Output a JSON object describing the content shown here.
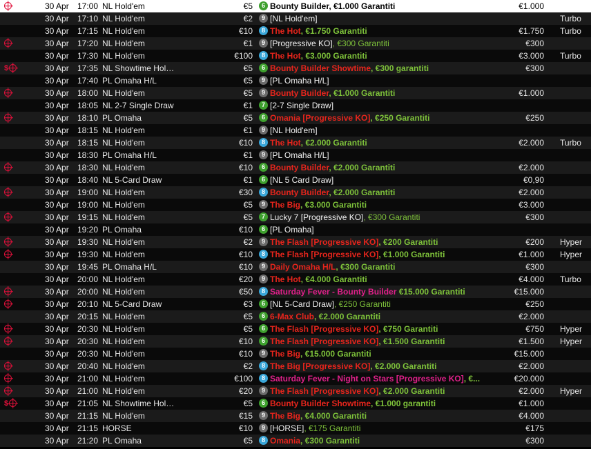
{
  "tournaments": [
    {
      "bounty": true,
      "cash": false,
      "date": "30 Apr",
      "time": "17:00",
      "game": "NL Hold'em",
      "buyin": "€5",
      "seats": "6",
      "name": [
        [
          "Bounty Builder, €1.000 Garantiti",
          "white"
        ]
      ],
      "prize": "€1.000",
      "speed": "",
      "selected": true
    },
    {
      "bounty": false,
      "cash": false,
      "date": "30 Apr",
      "time": "17:10",
      "game": "NL Hold'em",
      "buyin": "€2",
      "seats": "9",
      "name": [
        [
          "[NL Hold'em]",
          "white"
        ]
      ],
      "prize": "",
      "speed": "Turbo"
    },
    {
      "bounty": false,
      "cash": false,
      "date": "30 Apr",
      "time": "17:15",
      "game": "NL Hold'em",
      "buyin": "€10",
      "seats": "8",
      "name": [
        [
          "The Hot",
          "red"
        ],
        [
          ", €1.750 Garantiti",
          "greenb"
        ]
      ],
      "prize": "€1.750",
      "speed": "Turbo"
    },
    {
      "bounty": true,
      "cash": false,
      "date": "30 Apr",
      "time": "17:20",
      "game": "NL Hold'em",
      "buyin": "€1",
      "seats": "9",
      "name": [
        [
          "[Progressive KO]",
          "white"
        ],
        [
          ", €300 Garantiti",
          "green"
        ]
      ],
      "prize": "€300",
      "speed": ""
    },
    {
      "bounty": false,
      "cash": false,
      "date": "30 Apr",
      "time": "17:30",
      "game": "NL Hold'em",
      "buyin": "€100",
      "seats": "8",
      "name": [
        [
          "The Hot",
          "red"
        ],
        [
          ", €3.000 Garantiti",
          "greenb"
        ]
      ],
      "prize": "€3.000",
      "speed": "Turbo"
    },
    {
      "bounty": true,
      "cash": true,
      "date": "30 Apr",
      "time": "17:35",
      "game": "NL Showtime Hold'…",
      "buyin": "€5",
      "seats": "6",
      "name": [
        [
          "Bounty Builder Showtime",
          "red"
        ],
        [
          ", €300 garantiti",
          "greenb"
        ]
      ],
      "prize": "€300",
      "speed": ""
    },
    {
      "bounty": false,
      "cash": false,
      "date": "30 Apr",
      "time": "17:40",
      "game": "PL Omaha H/L",
      "buyin": "€5",
      "seats": "9",
      "name": [
        [
          "[PL Omaha H/L]",
          "white"
        ]
      ],
      "prize": "",
      "speed": ""
    },
    {
      "bounty": true,
      "cash": false,
      "date": "30 Apr",
      "time": "18:00",
      "game": "NL Hold'em",
      "buyin": "€5",
      "seats": "9",
      "name": [
        [
          "Bounty Builder",
          "red"
        ],
        [
          ", €1.000 Garantiti",
          "greenb"
        ]
      ],
      "prize": "€1.000",
      "speed": ""
    },
    {
      "bounty": false,
      "cash": false,
      "date": "30 Apr",
      "time": "18:05",
      "game": "NL 2-7 Single Draw",
      "buyin": "€1",
      "seats": "7",
      "name": [
        [
          "[2-7 Single Draw]",
          "white"
        ]
      ],
      "prize": "",
      "speed": ""
    },
    {
      "bounty": true,
      "cash": false,
      "date": "30 Apr",
      "time": "18:10",
      "game": "PL Omaha",
      "buyin": "€5",
      "seats": "6",
      "name": [
        [
          "Omania [Progressive KO]",
          "red"
        ],
        [
          ", €250 Garantiti",
          "greenb"
        ]
      ],
      "prize": "€250",
      "speed": ""
    },
    {
      "bounty": false,
      "cash": false,
      "date": "30 Apr",
      "time": "18:15",
      "game": "NL Hold'em",
      "buyin": "€1",
      "seats": "9",
      "name": [
        [
          "[NL Hold'em]",
          "white"
        ]
      ],
      "prize": "",
      "speed": ""
    },
    {
      "bounty": false,
      "cash": false,
      "date": "30 Apr",
      "time": "18:15",
      "game": "NL Hold'em",
      "buyin": "€10",
      "seats": "8",
      "name": [
        [
          "The Hot",
          "red"
        ],
        [
          ", €2.000 Garantiti",
          "greenb"
        ]
      ],
      "prize": "€2.000",
      "speed": "Turbo"
    },
    {
      "bounty": false,
      "cash": false,
      "date": "30 Apr",
      "time": "18:30",
      "game": "PL Omaha H/L",
      "buyin": "€1",
      "seats": "9",
      "name": [
        [
          "[PL Omaha H/L]",
          "white"
        ]
      ],
      "prize": "",
      "speed": ""
    },
    {
      "bounty": true,
      "cash": false,
      "date": "30 Apr",
      "time": "18:30",
      "game": "NL Hold'em",
      "buyin": "€10",
      "seats": "6",
      "name": [
        [
          "Bounty Builder",
          "red"
        ],
        [
          ", €2.000 Garantiti",
          "greenb"
        ]
      ],
      "prize": "€2.000",
      "speed": ""
    },
    {
      "bounty": false,
      "cash": false,
      "date": "30 Apr",
      "time": "18:40",
      "game": "NL 5-Card Draw",
      "buyin": "€1",
      "seats": "6",
      "name": [
        [
          "[NL 5 Card Draw]",
          "white"
        ]
      ],
      "prize": "€0,90",
      "speed": ""
    },
    {
      "bounty": true,
      "cash": false,
      "date": "30 Apr",
      "time": "19:00",
      "game": "NL Hold'em",
      "buyin": "€30",
      "seats": "8",
      "name": [
        [
          "Bounty Builder",
          "red"
        ],
        [
          ", €2.000 Garantiti",
          "greenb"
        ]
      ],
      "prize": "€2.000",
      "speed": ""
    },
    {
      "bounty": false,
      "cash": false,
      "date": "30 Apr",
      "time": "19:00",
      "game": "NL Hold'em",
      "buyin": "€5",
      "seats": "9",
      "name": [
        [
          "The Big",
          "red"
        ],
        [
          ", €3.000 Garantiti",
          "greenb"
        ]
      ],
      "prize": "€3.000",
      "speed": ""
    },
    {
      "bounty": true,
      "cash": false,
      "date": "30 Apr",
      "time": "19:15",
      "game": "NL Hold'em",
      "buyin": "€5",
      "seats": "7",
      "name": [
        [
          "Lucky 7 [Progressive KO]",
          "white"
        ],
        [
          ", €300 Garantiti",
          "green"
        ]
      ],
      "prize": "€300",
      "speed": ""
    },
    {
      "bounty": false,
      "cash": false,
      "date": "30 Apr",
      "time": "19:20",
      "game": "PL Omaha",
      "buyin": "€10",
      "seats": "6",
      "name": [
        [
          "[PL Omaha]",
          "white"
        ]
      ],
      "prize": "",
      "speed": ""
    },
    {
      "bounty": true,
      "cash": false,
      "date": "30 Apr",
      "time": "19:30",
      "game": "NL Hold'em",
      "buyin": "€2",
      "seats": "9",
      "name": [
        [
          "The Flash [Progressive KO]",
          "red"
        ],
        [
          ", €200 Garantiti",
          "greenb"
        ]
      ],
      "prize": "€200",
      "speed": "Hyper"
    },
    {
      "bounty": true,
      "cash": false,
      "date": "30 Apr",
      "time": "19:30",
      "game": "NL Hold'em",
      "buyin": "€10",
      "seats": "8",
      "name": [
        [
          "The Flash [Progressive KO]",
          "red"
        ],
        [
          ", €1.000 Garantiti",
          "greenb"
        ]
      ],
      "prize": "€1.000",
      "speed": "Hyper"
    },
    {
      "bounty": false,
      "cash": false,
      "date": "30 Apr",
      "time": "19:45",
      "game": "PL Omaha H/L",
      "buyin": "€10",
      "seats": "9",
      "name": [
        [
          "Daily Omaha H/L",
          "red"
        ],
        [
          ", €300 Garantiti",
          "greenb"
        ]
      ],
      "prize": "€300",
      "speed": ""
    },
    {
      "bounty": false,
      "cash": false,
      "date": "30 Apr",
      "time": "20:00",
      "game": "NL Hold'em",
      "buyin": "€20",
      "seats": "9",
      "name": [
        [
          "The Hot",
          "red"
        ],
        [
          ", €4.000 Garantiti",
          "greenb"
        ]
      ],
      "prize": "€4.000",
      "speed": "Turbo"
    },
    {
      "bounty": true,
      "cash": false,
      "date": "30 Apr",
      "time": "20:00",
      "game": "NL Hold'em",
      "buyin": "€50",
      "seats": "8",
      "name": [
        [
          "Saturday Fever - Bounty Builder",
          "pink"
        ],
        [
          " €15.000 Garantiti",
          "greenb"
        ]
      ],
      "prize": "€15.000",
      "speed": ""
    },
    {
      "bounty": true,
      "cash": false,
      "date": "30 Apr",
      "time": "20:10",
      "game": "NL 5-Card Draw",
      "buyin": "€3",
      "seats": "6",
      "name": [
        [
          "[NL 5-Card Draw]",
          "white"
        ],
        [
          ", €250 Garantiti",
          "green"
        ]
      ],
      "prize": "€250",
      "speed": ""
    },
    {
      "bounty": false,
      "cash": false,
      "date": "30 Apr",
      "time": "20:15",
      "game": "NL Hold'em",
      "buyin": "€5",
      "seats": "6",
      "name": [
        [
          "6-Max Club",
          "red"
        ],
        [
          ", €2.000 Garantiti",
          "greenb"
        ]
      ],
      "prize": "€2.000",
      "speed": ""
    },
    {
      "bounty": true,
      "cash": false,
      "date": "30 Apr",
      "time": "20:30",
      "game": "NL Hold'em",
      "buyin": "€5",
      "seats": "6",
      "name": [
        [
          "The Flash [Progressive KO]",
          "red"
        ],
        [
          ", €750 Garantiti",
          "greenb"
        ]
      ],
      "prize": "€750",
      "speed": "Hyper"
    },
    {
      "bounty": true,
      "cash": false,
      "date": "30 Apr",
      "time": "20:30",
      "game": "NL Hold'em",
      "buyin": "€10",
      "seats": "6",
      "name": [
        [
          "The Flash [Progressive KO]",
          "red"
        ],
        [
          ", €1.500 Garantiti",
          "greenb"
        ]
      ],
      "prize": "€1.500",
      "speed": "Hyper"
    },
    {
      "bounty": false,
      "cash": false,
      "date": "30 Apr",
      "time": "20:30",
      "game": "NL Hold'em",
      "buyin": "€10",
      "seats": "9",
      "name": [
        [
          "The Big",
          "red"
        ],
        [
          ", €15.000 Garantiti",
          "greenb"
        ]
      ],
      "prize": "€15.000",
      "speed": ""
    },
    {
      "bounty": true,
      "cash": false,
      "date": "30 Apr",
      "time": "20:40",
      "game": "NL Hold'em",
      "buyin": "€2",
      "seats": "8",
      "name": [
        [
          "The Big [Progressive KO]",
          "red"
        ],
        [
          ", €2.000 Garantiti",
          "greenb"
        ]
      ],
      "prize": "€2.000",
      "speed": ""
    },
    {
      "bounty": true,
      "cash": false,
      "date": "30 Apr",
      "time": "21:00",
      "game": "NL Hold'em",
      "buyin": "€100",
      "seats": "8",
      "name": [
        [
          "Saturday Fever - Night on Stars [Progressive KO]",
          "pink"
        ],
        [
          ", €...",
          "greenb"
        ]
      ],
      "prize": "€20.000",
      "speed": ""
    },
    {
      "bounty": true,
      "cash": false,
      "date": "30 Apr",
      "time": "21:00",
      "game": "NL Hold'em",
      "buyin": "€20",
      "seats": "9",
      "name": [
        [
          "The Flash [Progressive KO]",
          "red"
        ],
        [
          ", €2.000 Garantiti",
          "greenb"
        ]
      ],
      "prize": "€2.000",
      "speed": "Hyper"
    },
    {
      "bounty": true,
      "cash": true,
      "date": "30 Apr",
      "time": "21:05",
      "game": "NL Showtime Hold'…",
      "buyin": "€5",
      "seats": "6",
      "name": [
        [
          "Bounty Builder Showtime",
          "red"
        ],
        [
          ", €1.000 garantiti",
          "greenb"
        ]
      ],
      "prize": "€1.000",
      "speed": ""
    },
    {
      "bounty": false,
      "cash": false,
      "date": "30 Apr",
      "time": "21:15",
      "game": "NL Hold'em",
      "buyin": "€15",
      "seats": "9",
      "name": [
        [
          "The Big",
          "red"
        ],
        [
          ", €4.000 Garantiti",
          "greenb"
        ]
      ],
      "prize": "€4.000",
      "speed": ""
    },
    {
      "bounty": false,
      "cash": false,
      "date": "30 Apr",
      "time": "21:15",
      "game": "HORSE",
      "buyin": "€10",
      "seats": "9",
      "name": [
        [
          "[HORSE]",
          "white"
        ],
        [
          ", €175 Garantiti",
          "green"
        ]
      ],
      "prize": "€175",
      "speed": ""
    },
    {
      "bounty": false,
      "cash": false,
      "date": "30 Apr",
      "time": "21:20",
      "game": "PL Omaha",
      "buyin": "€5",
      "seats": "8",
      "name": [
        [
          "Omania",
          "red"
        ],
        [
          ", €300 Garantiti",
          "greenb"
        ]
      ],
      "prize": "€300",
      "speed": ""
    }
  ],
  "colors": {
    "accent_red": "#e8251c",
    "guarantee_green": "#7ec23a",
    "feature_pink": "#e0208a",
    "bounty_icon": "#e0103a",
    "badge_9": "#6b6b6b",
    "badge_8": "#3aa6d8",
    "badge_6": "#3ea02e"
  },
  "icons": {
    "bounty": "crosshair-icon",
    "cash": "dollar-icon"
  }
}
